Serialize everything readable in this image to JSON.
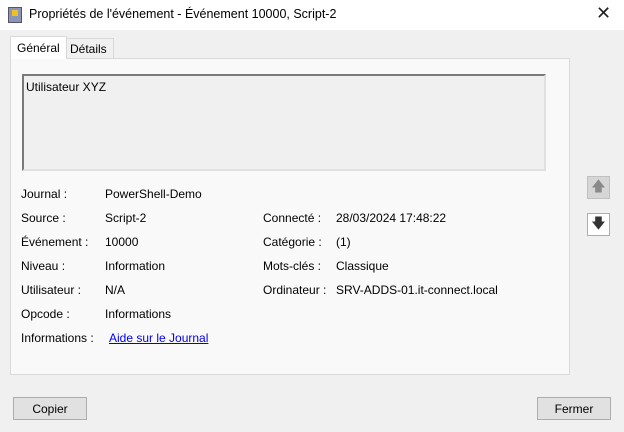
{
  "window": {
    "title": "Propriétés de l'événement - Événement 10000, Script-2",
    "close": "✕"
  },
  "tabs": [
    {
      "label": "Général"
    },
    {
      "label": "Détails"
    }
  ],
  "description": "Utilisateur XYZ",
  "fields": {
    "journal": {
      "label": "Journal :",
      "value": "PowerShell-Demo"
    },
    "source": {
      "label": "Source :",
      "value": "Script-2"
    },
    "evenement": {
      "label": "Événement :",
      "value": "10000"
    },
    "niveau": {
      "label": "Niveau :",
      "value": "Information"
    },
    "utilisateur": {
      "label": "Utilisateur :",
      "value": "N/A"
    },
    "opcode": {
      "label": "Opcode :",
      "value": "Informations"
    },
    "informations": {
      "label": "Informations :",
      "value": "Aide sur le Journal"
    },
    "connecte": {
      "label": "Connecté :",
      "value": "28/03/2024 17:48:22"
    },
    "categorie": {
      "label": "Catégorie :",
      "value": "(1)"
    },
    "motscles": {
      "label": "Mots-clés :",
      "value": "Classique"
    },
    "ordinateur": {
      "label": "Ordinateur :",
      "value": "SRV-ADDS-01.it-connect.local"
    }
  },
  "nav": {
    "up": "🡅",
    "down": "🡇"
  },
  "buttons": {
    "copy": "Copier",
    "close": "Fermer"
  }
}
